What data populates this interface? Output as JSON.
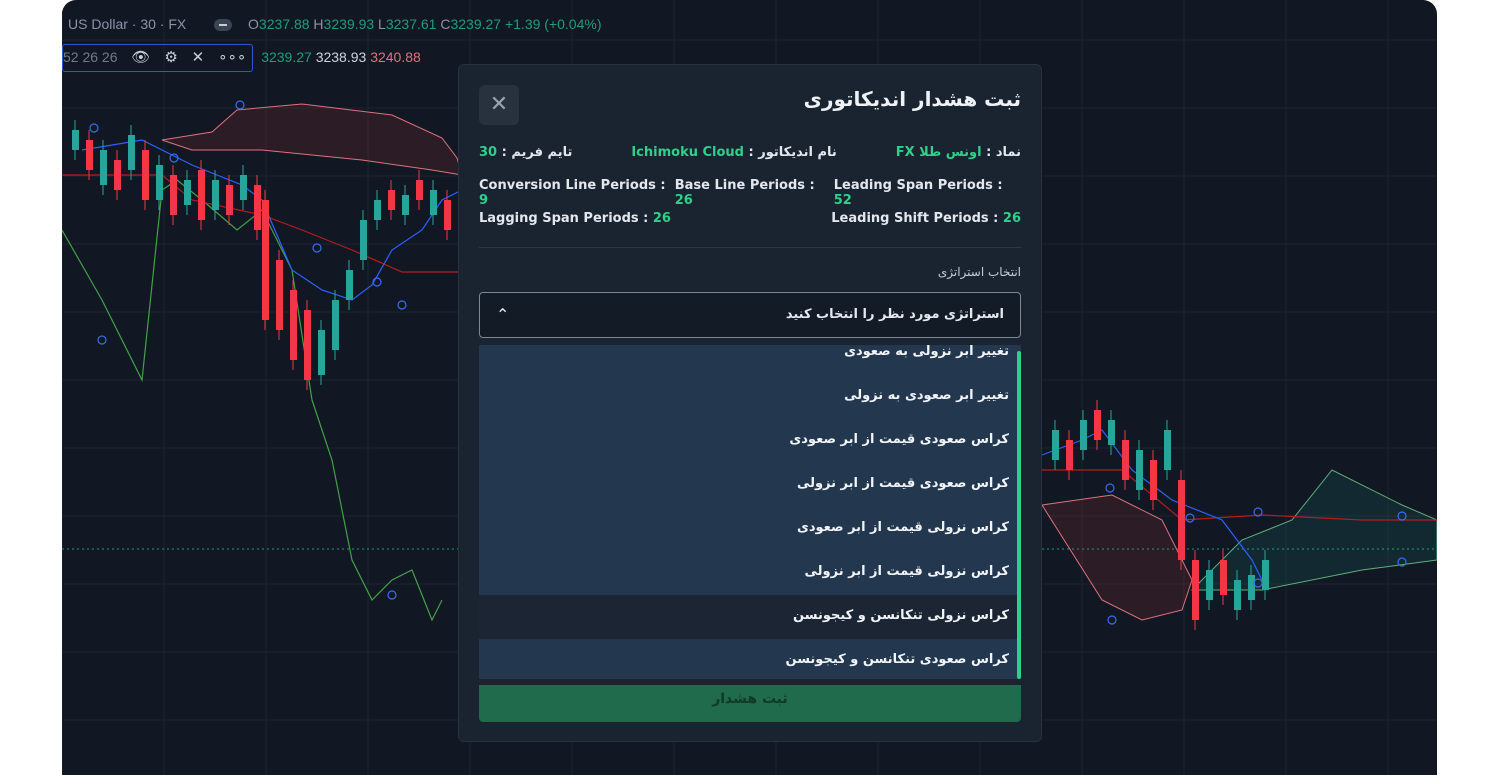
{
  "legend": {
    "symbol": "US Dollar · 30 · FX",
    "o_label": "O",
    "o": "3237.88",
    "h_label": "H",
    "h": "3239.93",
    "l_label": "L",
    "l": "3237.61",
    "c_label": "C",
    "c": "3239.27",
    "change": "+1.39 (+0.04%)"
  },
  "indicator": {
    "params": "52 26 26",
    "values": [
      "3239.27",
      "3238.93",
      "3240.88"
    ]
  },
  "modal": {
    "title": "ثبت هشدار اندیکاتوری",
    "symbol_label": "نماد : ",
    "symbol_value": "اونس طلا FX",
    "indicator_label": "نام اندیکاتور : ",
    "indicator_value": "Ichimoku Cloud",
    "timeframe_label": "تایم فریم : ",
    "timeframe_value": "30",
    "params": [
      {
        "label": "Leading Span Periods : ",
        "value": "52"
      },
      {
        "label": "Base Line Periods : ",
        "value": "26"
      },
      {
        "label": "Conversion Line Periods : ",
        "value": "9"
      },
      {
        "label": "Leading Shift Periods : ",
        "value": "26"
      },
      {
        "label": "Lagging Span Periods : ",
        "value": "26"
      }
    ],
    "strategy_label": "انتخاب استراتژی",
    "select_placeholder": "استراتژی مورد نظر را انتخاب کنید",
    "options": [
      "تغییر ابر نزولی به صعودی",
      "تغییر ابر صعودی به نزولی",
      "کراس صعودی قیمت از ابر صعودی",
      "کراس صعودی قیمت از ابر نزولی",
      "کراس نزولی قیمت از ابر صعودی",
      "کراس نزولی قیمت از ابر نزولی",
      "کراس نزولی تنکانسن و کیجونسن",
      "کراس صعودی تنکانسن و کیجونسن"
    ],
    "submit_label": "ثبت هشدار"
  },
  "colors": {
    "up": "#26a69a",
    "down": "#f23645",
    "tenkan": "#2962ff",
    "kijun": "#b71c1c",
    "chikou": "#43a047",
    "accent": "#2fd08a"
  }
}
